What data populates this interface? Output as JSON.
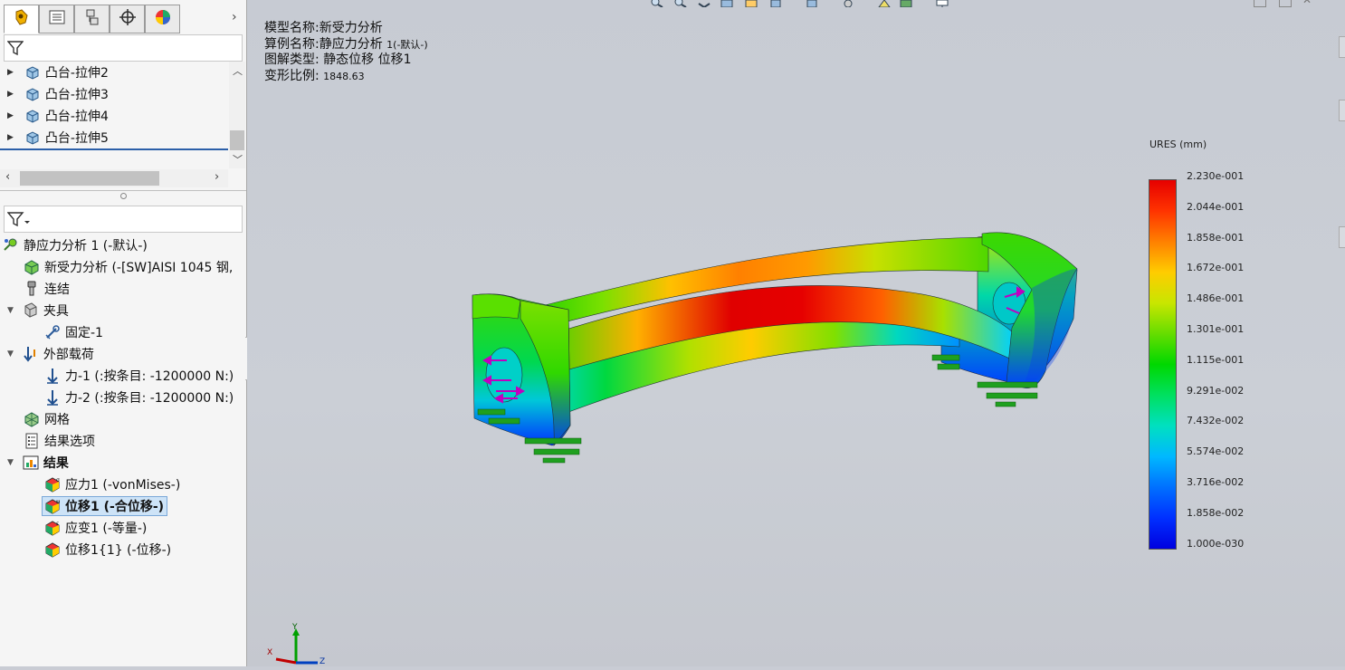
{
  "panel": {
    "tabs": [
      "feature-manager-tab",
      "property-manager-tab",
      "configuration-manager-tab",
      "dimxpert-tab",
      "display-manager-tab"
    ],
    "features": [
      {
        "label": "凸台-拉伸2"
      },
      {
        "label": "凸台-拉伸3"
      },
      {
        "label": "凸台-拉伸4"
      },
      {
        "label": "凸台-拉伸5"
      }
    ]
  },
  "sim_tree": {
    "study": "静应力分析 1 (-默认-)",
    "part": "新受力分析 (-[SW]AISI 1045 钢,",
    "connections": "连结",
    "fixtures": "夹具",
    "fixture_1": "固定-1",
    "loads": "外部载荷",
    "force_1": "力-1 (:按条目: -1200000 N:)",
    "force_2": "力-2 (:按条目: -1200000 N:)",
    "mesh": "网格",
    "result_options": "结果选项",
    "results": "结果",
    "stress1": "应力1 (-vonMises-)",
    "displacement1": "位移1 (-合位移-)",
    "strain1": "应变1 (-等量-)",
    "displacement1_1": "位移1{1} (-位移-)"
  },
  "viewport": {
    "model_name_label": "模型名称:",
    "model_name": "新受力分析",
    "study_name_label": "算例名称:",
    "study_name": "静应力分析",
    "study_suffix": "1(-默认-)",
    "plot_type_label": "图解类型:",
    "plot_type": "静态位移 位移1",
    "scale_label": "变形比例:",
    "scale_value": "1848.63",
    "axis_x": "X",
    "axis_y": "Y",
    "axis_z": "Z"
  },
  "legend": {
    "title": "URES (mm)",
    "values": [
      "2.230e-001",
      "2.044e-001",
      "1.858e-001",
      "1.672e-001",
      "1.486e-001",
      "1.301e-001",
      "1.115e-001",
      "9.291e-002",
      "7.432e-002",
      "5.574e-002",
      "3.716e-002",
      "1.858e-002",
      "1.000e-030"
    ],
    "colors": [
      "#e60000",
      "#ff3300",
      "#ff8000",
      "#ffcc00",
      "#c8e600",
      "#66dd00",
      "#00d800",
      "#00e060",
      "#00e0c0",
      "#00b8ff",
      "#0070ff",
      "#0030ff",
      "#0000e0"
    ]
  }
}
